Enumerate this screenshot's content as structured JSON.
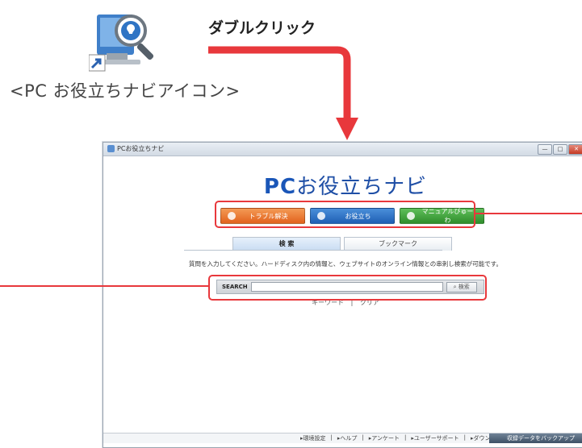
{
  "illustration": {
    "double_click_label": "ダブルクリック",
    "icon_caption": "<PC お役立ちナビアイコン>",
    "icon_name": "pc-otasuke-navi-icon",
    "highlight_color": "#e8383c"
  },
  "window": {
    "title": "PCお役立ちナビ",
    "controls": [
      "—",
      "□",
      "✕"
    ],
    "app_logo": {
      "pc": "PC",
      "rest": "お役立ちナビ"
    },
    "nav_buttons": [
      {
        "label": "トラブル解決",
        "icon": "trouble-icon",
        "color": "#e2621d"
      },
      {
        "label": "お役立ち",
        "icon": "otasuke-icon",
        "color": "#1f5fb4"
      },
      {
        "label": "マニュアルびゅーわ",
        "icon": "manual-icon",
        "color": "#2f8d2b"
      }
    ],
    "tabs": [
      {
        "label": "検 索",
        "active": true
      },
      {
        "label": "ブックマーク",
        "active": false
      }
    ],
    "search": {
      "description": "質問を入力してください。ハードディスク内の情報と、ウェブサイトのオンライン情報との串刺し検索が可能です。",
      "label": "SEARCH",
      "value": "",
      "button_label": "検索",
      "keyword_link": "キーワード",
      "separator": "|",
      "clear_link": "クリア"
    },
    "footer": {
      "links": [
        "▸環境設定",
        "|",
        "▸ヘルプ",
        "|",
        "▸アンケート",
        "|",
        "▸ユーザーサポート",
        "|",
        "▸ダウンロード"
      ],
      "backup_label": "収録データをバックアップ"
    }
  }
}
